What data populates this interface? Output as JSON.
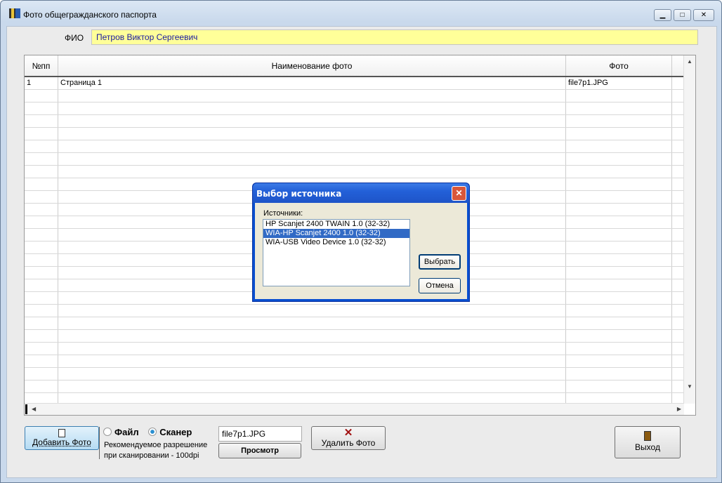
{
  "window": {
    "title": "Фото общегражданского паспорта",
    "min": "▁",
    "max": "□",
    "close": "✕"
  },
  "fio": {
    "label": "ФИО",
    "value": "Петров Виктор Сергеевич"
  },
  "grid": {
    "columns": [
      "№пп",
      "Наименование фото",
      "Фото"
    ],
    "rows": [
      {
        "num": "1",
        "name": "Страница 1",
        "photo": "file7p1.JPG"
      }
    ],
    "empty_rows": 25
  },
  "bottom": {
    "add_photo": "Добавить Фото",
    "radio_file": "Файл",
    "radio_scanner": "Сканер",
    "selected_source": "Сканер",
    "hint_line1": "Рекомендуемое разрешение",
    "hint_line2": "при сканировании - 100dpi",
    "file_value": "file7p1.JPG",
    "view": "Просмотр",
    "delete_photo": "Удалить Фото",
    "exit": "Выход"
  },
  "dialog": {
    "title": "Выбор источника",
    "sources_label": "Источники:",
    "sources": [
      "HP Scanjet 2400 TWAIN 1.0 (32-32)",
      "WIA-HP Scanjet 2400 1.0 (32-32)",
      "WIA-USB Video Device 1.0 (32-32)"
    ],
    "selected_index": 1,
    "select": "Выбрать",
    "cancel": "Отмена",
    "close": "✕"
  }
}
